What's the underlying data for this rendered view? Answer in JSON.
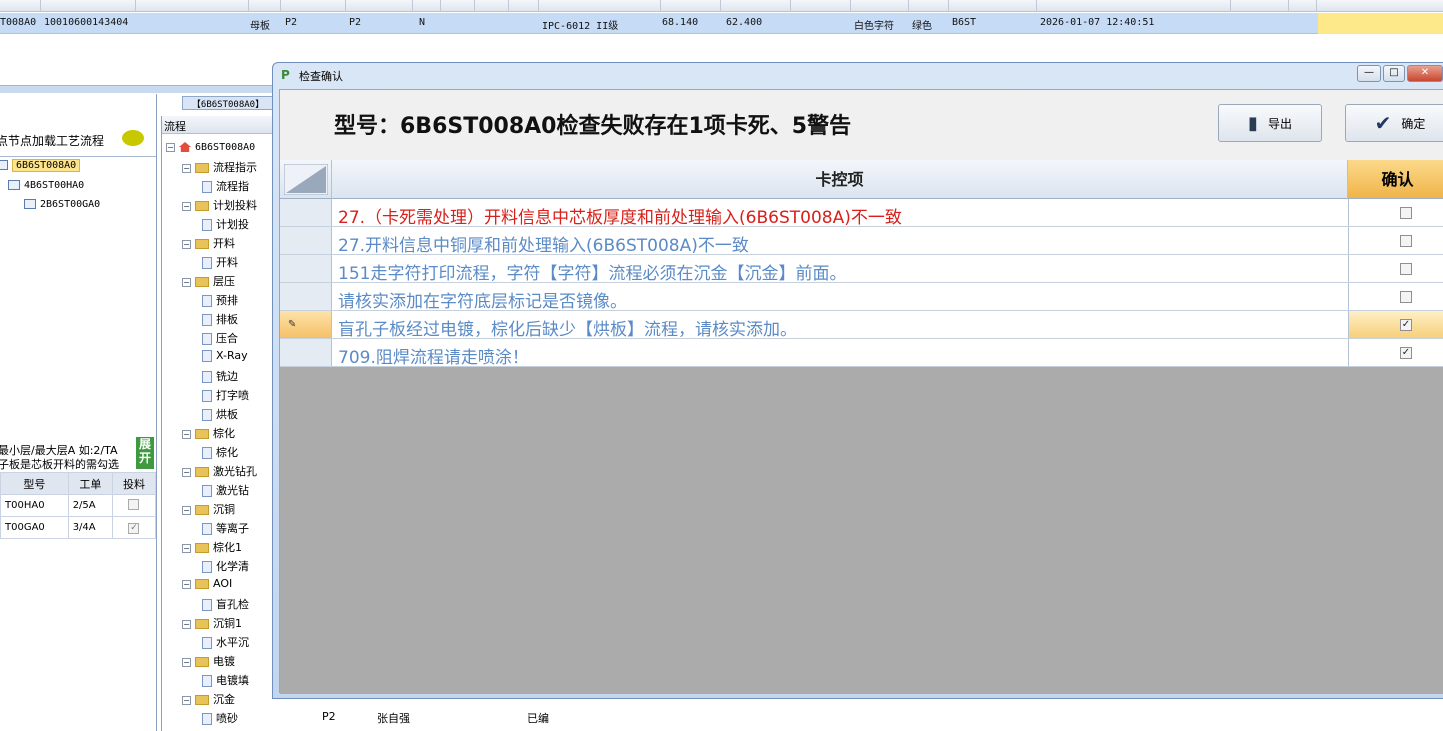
{
  "top_grid": {
    "row": [
      "T008A0",
      "10010600143404",
      "母板",
      "P2",
      "P2",
      "N",
      "IPC-6012 II级",
      "68.140",
      "62.400",
      "白色字符",
      "绿色",
      "B6ST",
      "2026-01-07 12:40:51"
    ]
  },
  "left_panel": {
    "title": "点节点加载工艺流程",
    "tree": [
      "6B6ST008A0",
      "4B6ST00HA0",
      "2B6ST00GA0"
    ],
    "info_line1": "最小层/最大层A 如:2/TA",
    "info_line2": "子板是芯板开料的需勾选",
    "expand_label": "展开",
    "table_headers": [
      "型号",
      "工单",
      "投料"
    ],
    "table_rows": [
      {
        "model": "T00HA0",
        "order": "2/5A",
        "checked": false
      },
      {
        "model": "T00GA0",
        "order": "3/4A",
        "checked": true
      }
    ]
  },
  "tab_label": "【6B6ST008A0】",
  "flow_tree": {
    "header": "流程",
    "root": "6B6ST008A0",
    "items": [
      {
        "label": "流程指示",
        "child": "流程指"
      },
      {
        "label": "计划投料",
        "child": "计划投"
      },
      {
        "label": "开料",
        "child": "开料"
      },
      {
        "label": "层压",
        "children": [
          "预排",
          "排板",
          "压合",
          "X-Ray",
          "铣边",
          "打字喷",
          "烘板"
        ]
      },
      {
        "label": "棕化",
        "child": "棕化"
      },
      {
        "label": "激光钻孔",
        "child": "激光钻"
      },
      {
        "label": "沉铜",
        "child": "等离子"
      },
      {
        "label": "棕化1",
        "child": "化学清"
      },
      {
        "label": "AOI",
        "child": "盲孔检"
      },
      {
        "label": "沉铜1",
        "child": "水平沉"
      },
      {
        "label": "电镀",
        "child": "电镀填"
      },
      {
        "label": "沉金",
        "child": "喷砂"
      }
    ]
  },
  "behind_grid": {
    "c1": "P2",
    "c2": "张自强",
    "c3": "已编"
  },
  "dialog": {
    "caption": "检查确认",
    "title": "型号：6B6ST008A0检查失败存在1项卡死、5警告",
    "export_label": "导出",
    "confirm_label": "确定",
    "columns": {
      "item": "卡控项",
      "confirm": "确认"
    },
    "rows": [
      {
        "text": "27.（卡死需处理）开料信息中芯板厚度和前处理输入(6B6ST008A)不一致",
        "critical": true,
        "checked": false
      },
      {
        "text": "27.开料信息中铜厚和前处理输入(6B6ST008A)不一致",
        "critical": false,
        "checked": false
      },
      {
        "text": "151走字符打印流程，字符【字符】流程必须在沉金【沉金】前面。",
        "critical": false,
        "checked": false
      },
      {
        "text": "请核实添加在字符底层标记是否镜像。",
        "critical": false,
        "checked": false
      },
      {
        "text": "盲孔子板经过电镀，棕化后缺少【烘板】流程，请核实添加。",
        "critical": false,
        "checked": true,
        "current": true
      },
      {
        "text": "709.阻焊流程请走喷涂！",
        "critical": false,
        "checked": true
      }
    ]
  },
  "colors": {
    "critical": "#d9201a",
    "warning": "#5b8bc7",
    "highlight": "#fde98a"
  }
}
